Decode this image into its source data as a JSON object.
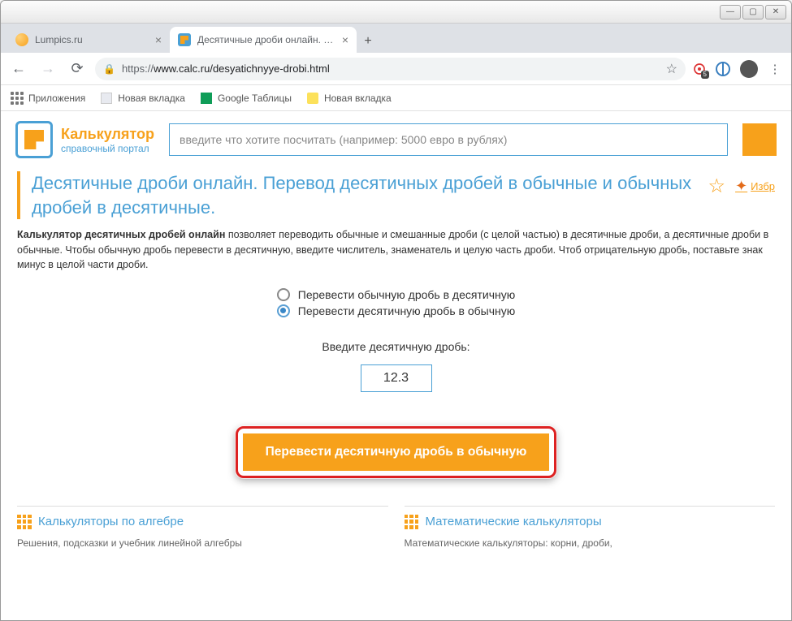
{
  "window": {
    "tabs": [
      {
        "title": "Lumpics.ru",
        "active": false
      },
      {
        "title": "Десятичные дроби онлайн. Пер",
        "active": true
      }
    ]
  },
  "toolbar": {
    "url_proto": "https://",
    "url_rest": "www.calc.ru/desyatichnyye-drobi.html",
    "ext_count": "5"
  },
  "bookmarks": [
    {
      "label": "Приложения",
      "icon": "apps"
    },
    {
      "label": "Новая вкладка",
      "icon": "doc"
    },
    {
      "label": "Google Таблицы",
      "icon": "sheet"
    },
    {
      "label": "Новая вкладка",
      "icon": "ytab"
    }
  ],
  "site": {
    "brand1": "Калькулятор",
    "brand2": "справочный портал",
    "search_placeholder": "введите что хотите посчитать (например: 5000 евро в рублях)"
  },
  "page": {
    "title": "Десятичные дроби онлайн. Перевод десятичных дробей в обычные и обычных дробей в десятичные.",
    "fav_label": "Избр",
    "intro_bold": "Калькулятор десятичных дробей онлайн",
    "intro_rest": " позволяет переводить обычные и смешанные дроби (с целой частью) в десятичные дроби, а десятичные дроби в обычные. Чтобы обычную дробь перевести в десятичную, введите числитель, знаменатель и целую часть дроби. Чтоб отрицательную дробь, поставьте знак минус в целой части дроби.",
    "options": [
      {
        "label": "Перевести обычную дробь в десятичную",
        "checked": false
      },
      {
        "label": "Перевести десятичную дробь в обычную",
        "checked": true
      }
    ],
    "input_label": "Введите десятичную дробь:",
    "input_value": "12.3",
    "submit_label": "Перевести десятичную дробь в обычную"
  },
  "footer": {
    "col1_title": "Калькуляторы по алгебре",
    "col1_sub": "Решения, подсказки и учебник линейной алгебры",
    "col2_title": "Математические калькуляторы",
    "col2_sub": "Математические калькуляторы: корни, дроби,"
  }
}
